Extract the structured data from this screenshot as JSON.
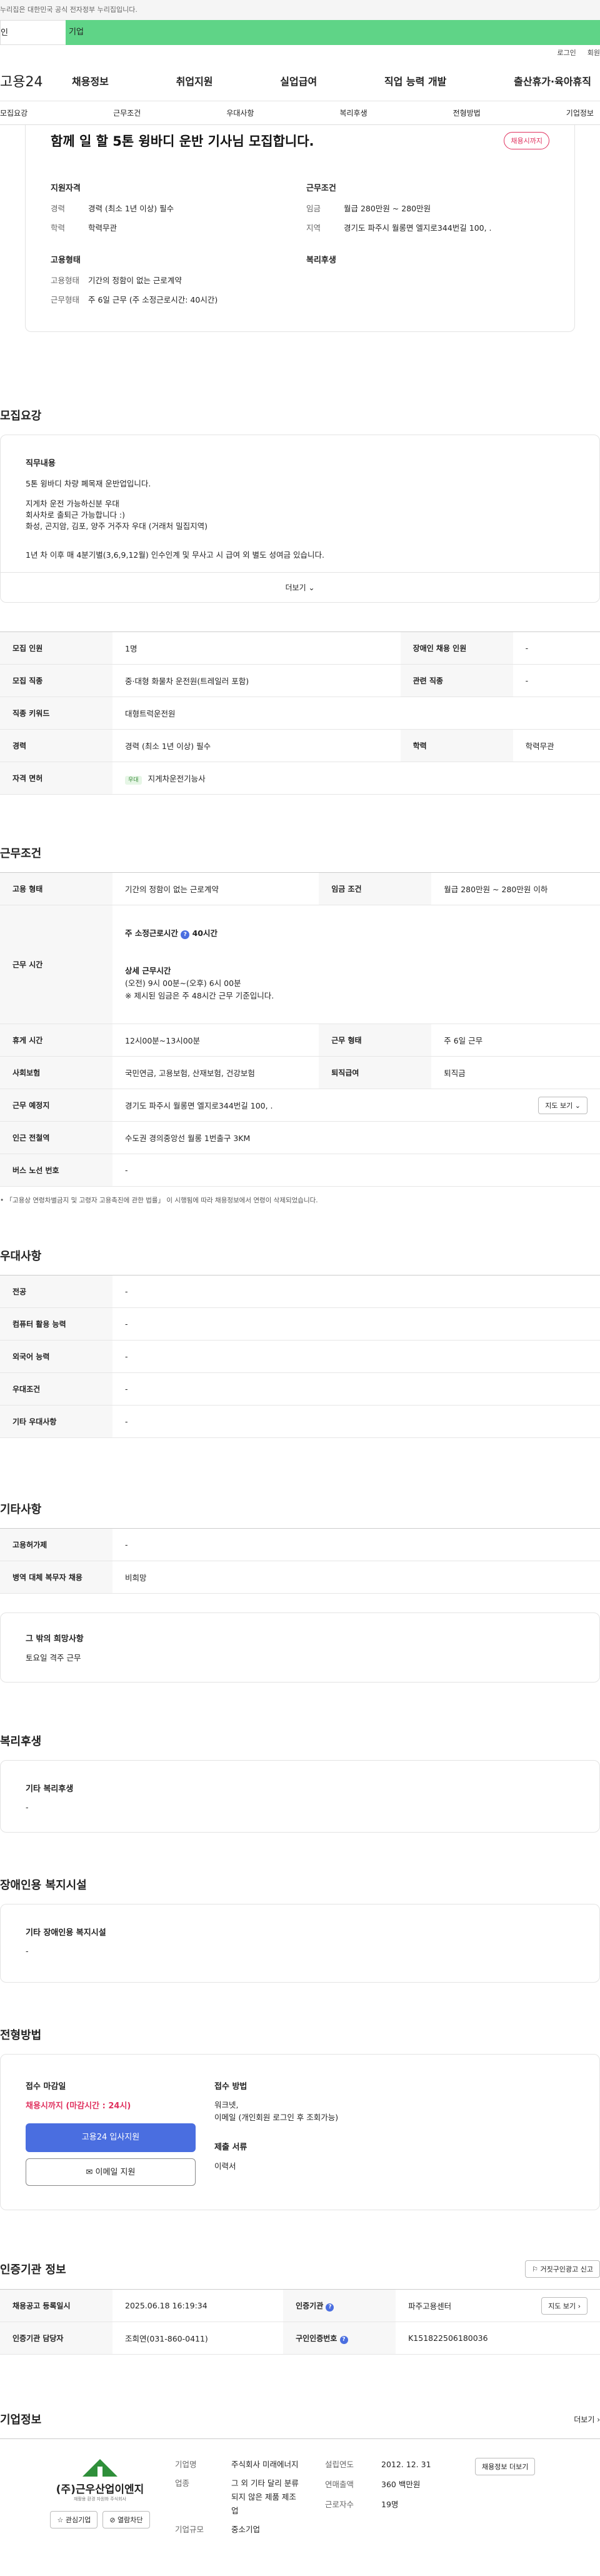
{
  "gov_notice": "누리집은 대한민국 공식 전자정부 누리집입니다.",
  "top_tabs": [
    "인",
    "기업"
  ],
  "util": [
    "로그인",
    "회원"
  ],
  "logo": "고용24",
  "gnb": [
    "채용정보",
    "취업지원",
    "실업급여",
    "직업 능력 개발",
    "출산휴가·육아휴직"
  ],
  "anchors": [
    "모집요강",
    "근무조건",
    "우대사항",
    "복리후생",
    "전형방법",
    "기업정보"
  ],
  "job_title": "함께 일 할 5톤 윙바디 운반 기사님 모집합니다.",
  "status_pill": "채용시까지",
  "summary": {
    "qual_h": "지원자격",
    "career_k": "경력",
    "career_v": "경력 (최소 1년 이상) 필수",
    "edu_k": "학력",
    "edu_v": "학력무관",
    "cond_h": "근무조건",
    "wage_k": "임금",
    "wage_v": "월급 280만원 ~ 280만원",
    "area_k": "지역",
    "area_v": "경기도 파주시 월롱면 엘지로344번길 100, .",
    "emp_h": "고용형태",
    "type_k": "고용형태",
    "type_v": "기간의 정함이 없는 근로계약",
    "hours_k": "근무형태",
    "hours_v": "주 6일 근무 (주 소정근로시간: 40시간)",
    "welfare_h": "복리후생"
  },
  "recruit": {
    "title": "모집요강",
    "duty_h": "직무내용",
    "lines": [
      "5톤 윙바디 차량 폐목재 운반업입니다.",
      "",
      "지게차 운전 가능하신분 우대",
      "회사차로 출퇴근 가능합니다 :)",
      "화성, 곤지암, 김포, 양주 거주자 우대 (거래처 밀집지역)",
      "",
      "1년 차 이후 매 4분기별(3,6,9,12월) 인수인계 및 무사고 시 급여 외 별도 성여금 있습니다."
    ],
    "more": "더보기",
    "rows": [
      [
        "모집 인원",
        "1명",
        "장애인 채용 인원",
        "-"
      ],
      [
        "모집 직종",
        "중·대형 화물차 운전원(트레일러 포함)",
        "관련 직종",
        "-"
      ],
      [
        "직종 키워드",
        "대형트럭운전원",
        "",
        ""
      ],
      [
        "경력",
        "경력 (최소 1년 이상) 필수",
        "학력",
        "학력무관"
      ],
      [
        "자격 면허",
        "지게차운전기능사",
        "",
        ""
      ]
    ],
    "license_badge": "우대"
  },
  "work": {
    "title": "근무조건",
    "type_k": "고용 형태",
    "type_v": "기간의 정함이 없는 근로계약",
    "wage_k": "임금 조건",
    "wage_v": "월급 280만원 ~ 280만원 이하",
    "hours_k": "근무 시간",
    "hours_a": "주 소정근로시간",
    "hours_b": "40시간",
    "detail_h": "상세 근무시간",
    "detail_1": "(오전) 9시 00분~(오후) 6시 00분",
    "detail_2": "※ 제시된 임금은 주 48시간 근무 기준입니다.",
    "rest_k": "휴게 시간",
    "rest_v": "12시00분~13시00분",
    "form_k": "근무 형태",
    "form_v": "주 6일 근무",
    "ins_k": "사회보험",
    "ins_v": "국민연금, 고용보험, 산재보험, 건강보험",
    "sev_k": "퇴직급여",
    "sev_v": "퇴직금",
    "place_k": "근무 예정지",
    "place_v": "경기도 파주시 월롱면 엘지로344번길 100, .",
    "map_btn": "지도 보기",
    "subway_k": "인근 전철역",
    "subway_v": "수도권 경의중앙선 월롱 1번출구 3KM",
    "bus_k": "버스 노선 번호",
    "bus_v": "-",
    "note": "「고용상 연령차별금지 및 고령자 고용촉진에 관한 법률」 이 시행됨에 따라 채용정보에서 연령이 삭제되었습니다."
  },
  "pref": {
    "title": "우대사항",
    "rows": [
      [
        "전공",
        "-"
      ],
      [
        "컴퓨터 활용 능력",
        "-"
      ],
      [
        "외국어 능력",
        "-"
      ],
      [
        "우대조건",
        "-"
      ],
      [
        "기타 우대사항",
        "-"
      ]
    ]
  },
  "etc": {
    "title": "기타사항",
    "rows": [
      [
        "고용허가제",
        "-"
      ],
      [
        "병역 대체 복무자 채용",
        "비희망"
      ]
    ],
    "hope_h": "그 밖의 희망사항",
    "hope_v": "토요일 격주 근무"
  },
  "welfare": {
    "title": "복리후생",
    "h": "기타 복리후생",
    "v": "-"
  },
  "disab": {
    "title": "장애인용 복지시설",
    "h": "기타 장애인용 복지시설",
    "v": "-"
  },
  "process": {
    "title": "전형방법",
    "dead_h": "접수 마감일",
    "dead_v": "채용시까지 (마감시간 : 24시)",
    "apply_btn": "고용24 입사지원",
    "mail_btn": "이메일 지원",
    "method_h": "접수 방법",
    "method_v1": "워크넷,",
    "method_v2": "이메일 (개인회원 로그인 후 조회가능)",
    "docs_h": "제출 서류",
    "docs_v": "이력서"
  },
  "auth": {
    "title": "인증기관 정보",
    "report_btn": "거짓구인광고 신고",
    "reg_k": "채용공고 등록일시",
    "reg_v": "2025.06.18 16:19:34",
    "org_k": "인증기관",
    "org_v": "파주고용센터",
    "map_btn": "지도 보기",
    "mgr_k": "인증기관 담당자",
    "mgr_v": "조희연(031-860-0411)",
    "num_k": "구인인증번호",
    "num_v": "K151822506180036"
  },
  "company": {
    "title": "기업정보",
    "more": "더보기",
    "logo_text": "(주)근우산업이엔지",
    "logo_sub": "재활용 환경 자원화 주식회사",
    "fav": "관심기업",
    "block": "열람차단",
    "name_k": "기업명",
    "name_v": "주식회사 미래에너지",
    "biz_k": "업종",
    "biz_v": "그 외 기타 달리 분류되지 않은 제품 제조업",
    "size_k": "기업규모",
    "size_v": "중소기업",
    "est_k": "설립연도",
    "est_v": "2012. 12. 31",
    "sales_k": "연매출액",
    "sales_v": "360 백만원",
    "emp_k": "근로자수",
    "emp_v": "19명",
    "other_btn": "채용정보 더보기"
  }
}
